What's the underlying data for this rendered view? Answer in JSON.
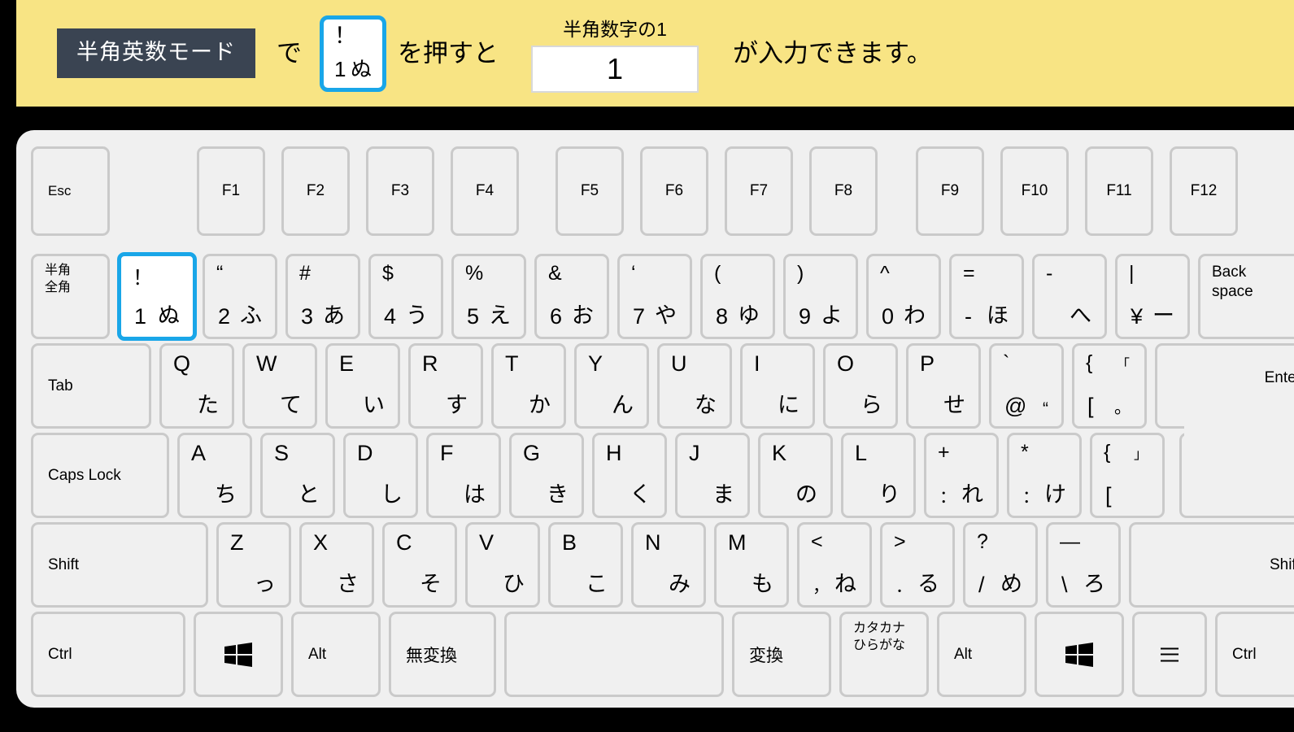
{
  "banner": {
    "mode_badge": "半角英数モード",
    "text_de": "で",
    "key_top": "！",
    "key_bottom": "1",
    "key_kana": "ぬ",
    "text_press": "を押すと",
    "output_caption": "半角数字の1",
    "output_value": "1",
    "text_result": "が入力できます。",
    "bg_color": "#F8E484",
    "badge_color": "#3A4452",
    "highlight_color": "#19A6E8"
  },
  "keyboard": {
    "body_color": "#F0F0F0",
    "key_fill": "#F0F0F0",
    "key_border": "#CACACA",
    "highlight_color": "#19A6E8",
    "function_row": [
      {
        "label": "Esc"
      },
      {
        "label": "F1"
      },
      {
        "label": "F2"
      },
      {
        "label": "F3"
      },
      {
        "label": "F4"
      },
      {
        "label": "F5"
      },
      {
        "label": "F6"
      },
      {
        "label": "F7"
      },
      {
        "label": "F8"
      },
      {
        "label": "F9"
      },
      {
        "label": "F10"
      },
      {
        "label": "F11"
      },
      {
        "label": "F12"
      }
    ],
    "number_row": [
      {
        "line1": "半角",
        "line2": "全角"
      },
      {
        "top": "！",
        "base": "1",
        "kana": "ぬ",
        "highlight": true
      },
      {
        "top": "“",
        "base": "2",
        "kana": "ふ"
      },
      {
        "top": "#",
        "base": "3",
        "kana": "あ"
      },
      {
        "top": "$",
        "base": "4",
        "kana": "う"
      },
      {
        "top": "%",
        "base": "5",
        "kana": "え"
      },
      {
        "top": "&",
        "base": "6",
        "kana": "お"
      },
      {
        "top": "‘",
        "base": "7",
        "kana": "や"
      },
      {
        "top": "(",
        "base": "8",
        "kana": "ゆ"
      },
      {
        "top": ")",
        "base": "9",
        "kana": "よ"
      },
      {
        "top": "^",
        "base": "0",
        "kana": "わ"
      },
      {
        "top": "=",
        "base": "-",
        "kana": "ほ"
      },
      {
        "top": "-",
        "base": "",
        "kana": "へ"
      },
      {
        "top": "|",
        "base": "¥",
        "kana": "ー"
      },
      {
        "line1": "Back",
        "line2": "space"
      }
    ],
    "qwerty_row": [
      {
        "label": "Tab"
      },
      {
        "letter": "Q",
        "kana": "た"
      },
      {
        "letter": "W",
        "kana": "て"
      },
      {
        "letter": "E",
        "kana": "い"
      },
      {
        "letter": "R",
        "kana": "す"
      },
      {
        "letter": "T",
        "kana": "か"
      },
      {
        "letter": "Y",
        "kana": "ん"
      },
      {
        "letter": "U",
        "kana": "な"
      },
      {
        "letter": "I",
        "kana": "に"
      },
      {
        "letter": "O",
        "kana": "ら"
      },
      {
        "letter": "P",
        "kana": "せ"
      },
      {
        "top": "`",
        "base": "@",
        "kana": "“"
      },
      {
        "top": "{",
        "base": "[",
        "kana_top": "「",
        "kana": "。"
      },
      {
        "label": "Enter"
      }
    ],
    "home_row": [
      {
        "label": "Caps Lock"
      },
      {
        "letter": "A",
        "kana": "ち"
      },
      {
        "letter": "S",
        "kana": "と"
      },
      {
        "letter": "D",
        "kana": "し"
      },
      {
        "letter": "F",
        "kana": "は"
      },
      {
        "letter": "G",
        "kana": "き"
      },
      {
        "letter": "H",
        "kana": "く"
      },
      {
        "letter": "J",
        "kana": "ま"
      },
      {
        "letter": "K",
        "kana": "の"
      },
      {
        "letter": "L",
        "kana": "り"
      },
      {
        "top": "+",
        "base": "：",
        "kana": "れ"
      },
      {
        "top": "*",
        "base": "：",
        "kana": "け"
      },
      {
        "top": "{",
        "base": "[",
        "kana_top": "」"
      }
    ],
    "shift_row": [
      {
        "label": "Shift"
      },
      {
        "letter": "Z",
        "kana": "っ"
      },
      {
        "letter": "X",
        "kana": "さ"
      },
      {
        "letter": "C",
        "kana": "そ"
      },
      {
        "letter": "V",
        "kana": "ひ"
      },
      {
        "letter": "B",
        "kana": "こ"
      },
      {
        "letter": "N",
        "kana": "み"
      },
      {
        "letter": "M",
        "kana": "も"
      },
      {
        "top": "<",
        "base": "，",
        "kana": "ね"
      },
      {
        "top": ">",
        "base": "．",
        "kana": "る"
      },
      {
        "top": "?",
        "base": "/",
        "kana": "め"
      },
      {
        "top": "—",
        "base": "\\",
        "kana": "ろ"
      },
      {
        "label": "Shift"
      }
    ],
    "bottom_row": [
      {
        "label": "Ctrl"
      },
      {
        "icon": "windows-icon"
      },
      {
        "label": "Alt"
      },
      {
        "label": "無変換"
      },
      {
        "label": ""
      },
      {
        "label": "変換"
      },
      {
        "line1": "カタカナ",
        "line2": "ひらがな"
      },
      {
        "label": "Alt"
      },
      {
        "icon": "windows-icon"
      },
      {
        "icon": "menu-icon"
      },
      {
        "label": "Ctrl"
      }
    ]
  }
}
